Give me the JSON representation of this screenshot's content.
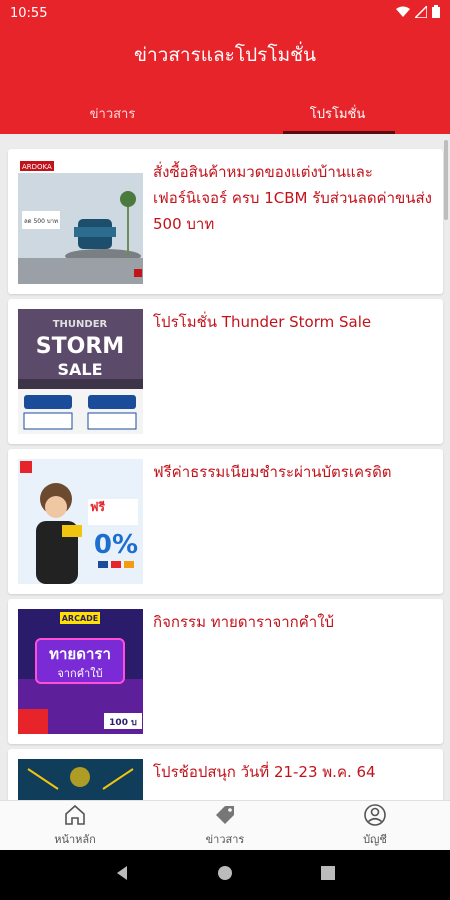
{
  "status": {
    "time": "10:55"
  },
  "app": {
    "title": "ข่าวสารและโปรโมชั่น"
  },
  "tabs": [
    {
      "label": "ข่าวสาร",
      "active": false
    },
    {
      "label": "โปรโมชั่น",
      "active": true
    }
  ],
  "promotions": [
    {
      "title": "สั่งซื้อสินค้าหมวดของแต่งบ้านและเฟอร์นิเจอร์ ครบ 1CBM รับส่วนลดค่าขนส่ง 500 บาท",
      "thumb": {
        "brand": "ARDOKA",
        "price": "ลด 500 บาท"
      }
    },
    {
      "title": "โปรโมชั่น Thunder Storm Sale",
      "thumb": {
        "line1": "THUNDER",
        "line2": "STORM",
        "line3": "SALE"
      }
    },
    {
      "title": "ฟรีค่าธรรมเนียมชำระผ่านบัตรเครดิต",
      "thumb": {
        "free": "ฟรี",
        "rate": "0%"
      }
    },
    {
      "title": "กิจกรรม ทายดาราจากคำใบ้",
      "thumb": {
        "badge": "ARCADE",
        "line1": "ทายดารา",
        "line2": "จากคำใบ้",
        "price": "100 บ"
      }
    },
    {
      "title": "โปรช้อปสนุก วันที่ 21-23 พ.ค. 64",
      "thumb": {}
    }
  ],
  "bottom_nav": [
    {
      "label": "หน้าหลัก",
      "icon": "home-icon"
    },
    {
      "label": "ข่าวสาร",
      "icon": "tag-icon"
    },
    {
      "label": "บัญชี",
      "icon": "account-icon"
    }
  ],
  "colors": {
    "brand_red": "#e8242b",
    "title_red": "#c2131b"
  }
}
